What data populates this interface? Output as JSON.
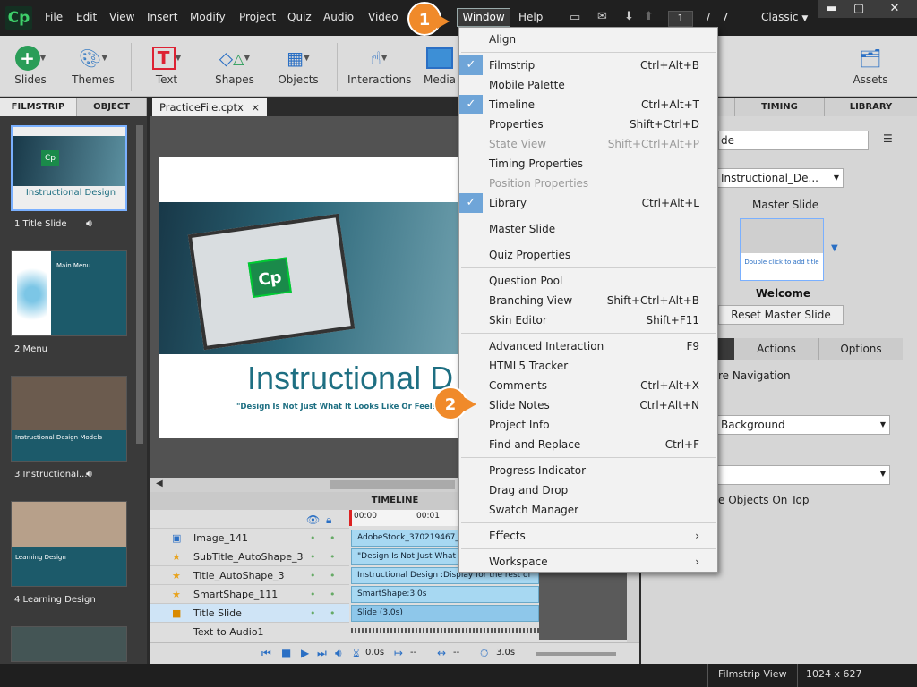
{
  "menubar": {
    "logo": "Cp",
    "items": [
      "File",
      "Edit",
      "View",
      "Insert",
      "Modify",
      "Project",
      "Quiz",
      "Audio",
      "Video",
      "Window",
      "Help"
    ],
    "page_current": "1",
    "page_sep": "/",
    "page_total": "7",
    "workspace": "Classic"
  },
  "toolbar": {
    "slides": "Slides",
    "themes": "Themes",
    "text": "Text",
    "shapes": "Shapes",
    "objects": "Objects",
    "interactions": "Interactions",
    "media": "Media",
    "assets": "Assets"
  },
  "panel_tabs": {
    "filmstrip": "FILMSTRIP",
    "object_state": "OBJECT STATE"
  },
  "document_tab": {
    "name": "PracticeFile.cptx",
    "close": "×"
  },
  "filmstrip": [
    {
      "label": "1 Title Slide",
      "title": "Instructional Design",
      "audio": true
    },
    {
      "label": "2 Menu",
      "title": "Main Menu",
      "audio": false
    },
    {
      "label": "3 Instructional...",
      "title": "Instructional Design Models",
      "audio": true
    },
    {
      "label": "4 Learning Design",
      "title": "Learning Design",
      "audio": false
    }
  ],
  "slide": {
    "title": "Instructional D",
    "subtitle": "\"Design Is Not Just What It Looks Like Or Feels Like, B",
    "logo": "Cp"
  },
  "timeline": {
    "header": "TIMELINE",
    "ruler": [
      "00:00",
      "00:01"
    ],
    "rows": [
      {
        "name": "Image_141",
        "bar": "AdobeStock_370219467_ed"
      },
      {
        "name": "SubTitle_AutoShape_3",
        "bar": "\"Design Is Not Just What It"
      },
      {
        "name": "Title_AutoShape_3",
        "bar": "Instructional Design :Display for the rest of"
      },
      {
        "name": "SmartShape_111",
        "bar": "SmartShape:3.0s"
      },
      {
        "name": "Title Slide",
        "bar": "Slide (3.0s)"
      },
      {
        "name": "Text to Audio1",
        "bar": ""
      }
    ],
    "playhead_time": "0.0s",
    "lead": "--",
    "duration_mark": "--",
    "duration": "3.0s"
  },
  "properties": {
    "tabs": [
      "TIMING",
      "LIBRARY"
    ],
    "name_field": "de",
    "master_select": "Instructional_De...",
    "master_label": "Master Slide",
    "master_thumb_text": "Double click to add title",
    "master_name": "Welcome",
    "reset_button": "Reset Master Slide",
    "sub_tabs": [
      "Actions",
      "Options"
    ],
    "nav_text": "re Navigation",
    "bg_select": "Background",
    "objects_top": "e Objects On Top"
  },
  "window_menu": [
    {
      "label": "Align",
      "shortcut": "",
      "checked": false,
      "disabled": false
    },
    {
      "sep": true
    },
    {
      "label": "Filmstrip",
      "shortcut": "Ctrl+Alt+B",
      "checked": true,
      "disabled": false
    },
    {
      "label": "Mobile Palette",
      "shortcut": "",
      "checked": false,
      "disabled": false
    },
    {
      "label": "Timeline",
      "shortcut": "Ctrl+Alt+T",
      "checked": true,
      "disabled": false
    },
    {
      "label": "Properties",
      "shortcut": "Shift+Ctrl+D",
      "checked": false,
      "disabled": false
    },
    {
      "label": "State View",
      "shortcut": "Shift+Ctrl+Alt+P",
      "checked": false,
      "disabled": true
    },
    {
      "label": "Timing Properties",
      "shortcut": "",
      "checked": false,
      "disabled": false
    },
    {
      "label": "Position Properties",
      "shortcut": "",
      "checked": false,
      "disabled": true
    },
    {
      "label": "Library",
      "shortcut": "Ctrl+Alt+L",
      "checked": true,
      "disabled": false
    },
    {
      "sep": true
    },
    {
      "label": "Master Slide",
      "shortcut": "",
      "checked": false,
      "disabled": false
    },
    {
      "sep": true
    },
    {
      "label": "Quiz Properties",
      "shortcut": "",
      "checked": false,
      "disabled": false
    },
    {
      "sep": true
    },
    {
      "label": "Question Pool",
      "shortcut": "",
      "checked": false,
      "disabled": false
    },
    {
      "label": "Branching View",
      "shortcut": "Shift+Ctrl+Alt+B",
      "checked": false,
      "disabled": false
    },
    {
      "label": "Skin Editor",
      "shortcut": "Shift+F11",
      "checked": false,
      "disabled": false
    },
    {
      "sep": true
    },
    {
      "label": "Advanced Interaction",
      "shortcut": "F9",
      "checked": false,
      "disabled": false
    },
    {
      "label": "HTML5 Tracker",
      "shortcut": "",
      "checked": false,
      "disabled": false
    },
    {
      "label": "Comments",
      "shortcut": "Ctrl+Alt+X",
      "checked": false,
      "disabled": false
    },
    {
      "label": "Slide Notes",
      "shortcut": "Ctrl+Alt+N",
      "checked": false,
      "disabled": false
    },
    {
      "label": "Project Info",
      "shortcut": "",
      "checked": false,
      "disabled": false
    },
    {
      "label": "Find and Replace",
      "shortcut": "Ctrl+F",
      "checked": false,
      "disabled": false
    },
    {
      "sep": true
    },
    {
      "label": "Progress Indicator",
      "shortcut": "",
      "checked": false,
      "disabled": false
    },
    {
      "label": "Drag and Drop",
      "shortcut": "",
      "checked": false,
      "disabled": false
    },
    {
      "label": "Swatch Manager",
      "shortcut": "",
      "checked": false,
      "disabled": false
    },
    {
      "sep": true
    },
    {
      "label": "Effects",
      "shortcut": "›",
      "checked": false,
      "disabled": false
    },
    {
      "sep": true
    },
    {
      "label": "Workspace",
      "shortcut": "›",
      "checked": false,
      "disabled": false
    }
  ],
  "callouts": [
    "1",
    "2"
  ],
  "status": {
    "view": "Filmstrip View",
    "size": "1024 x 627"
  },
  "colors": {
    "accent": "#f08a2a",
    "check": "#6fa5d8",
    "teal_title": "#1e6f82"
  }
}
